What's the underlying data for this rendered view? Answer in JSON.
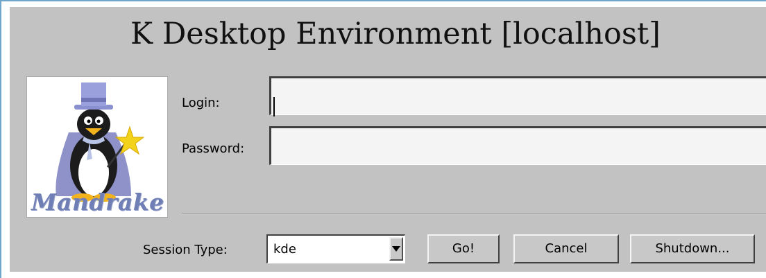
{
  "window": {
    "title": "K Desktop Environment [localhost]"
  },
  "logo": {
    "text": "Mandrake",
    "icon": "penguin-wizard-icon"
  },
  "form": {
    "login_label": "Login:",
    "login_value": "",
    "password_label": "Password:",
    "password_value": ""
  },
  "session": {
    "label": "Session Type:",
    "selected": "kde",
    "dropdown_icon": "triangle-down-icon"
  },
  "buttons": {
    "go": "Go!",
    "cancel": "Cancel",
    "shutdown": "Shutdown..."
  },
  "colors": {
    "panel_bg": "#c2c2c2",
    "window_border": "#6ea5c8",
    "logo_text": "#6f7fb6"
  }
}
